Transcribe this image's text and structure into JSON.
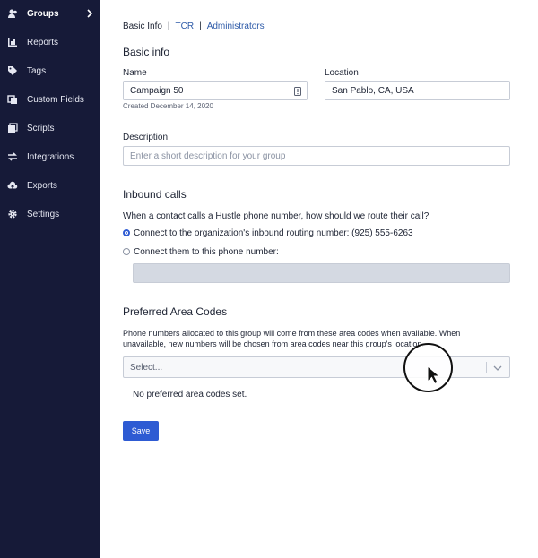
{
  "sidebar": {
    "items": [
      {
        "label": "Groups",
        "icon": "users-icon",
        "active": true
      },
      {
        "label": "Reports",
        "icon": "bar-chart-icon"
      },
      {
        "label": "Tags",
        "icon": "tag-icon"
      },
      {
        "label": "Custom Fields",
        "icon": "custom-fields-icon"
      },
      {
        "label": "Scripts",
        "icon": "scripts-icon"
      },
      {
        "label": "Integrations",
        "icon": "integrations-icon"
      },
      {
        "label": "Exports",
        "icon": "cloud-upload-icon"
      },
      {
        "label": "Settings",
        "icon": "gear-icon"
      }
    ]
  },
  "tabs": {
    "basic_info": "Basic Info",
    "separator": "|",
    "tcr": "TCR",
    "administrators": "Administrators"
  },
  "basic_info": {
    "heading": "Basic info",
    "name_label": "Name",
    "name_value": "Campaign 50",
    "created_text": "Created December 14, 2020",
    "location_label": "Location",
    "location_value": "San Pablo, CA, USA",
    "description_label": "Description",
    "description_placeholder": "Enter a short description for your group"
  },
  "inbound_calls": {
    "heading": "Inbound calls",
    "question": "When a contact calls a Hustle phone number, how should we route their call?",
    "option_1": "Connect to the organization's inbound routing number: (925) 555-6263",
    "option_2": "Connect them to this phone number:",
    "selected_option": 1
  },
  "area_codes": {
    "heading": "Preferred Area Codes",
    "description_line1": "Phone numbers allocated to this group will come from these area codes when available. When",
    "description_line2": "unavailable, new numbers will be chosen from area codes near this group's location.",
    "select_placeholder": "Select...",
    "empty_text": "No preferred area codes set."
  },
  "save_label": "Save",
  "colors": {
    "sidebar_bg": "#161a38",
    "accent": "#2e5bd3",
    "link": "#2d5aa8"
  }
}
